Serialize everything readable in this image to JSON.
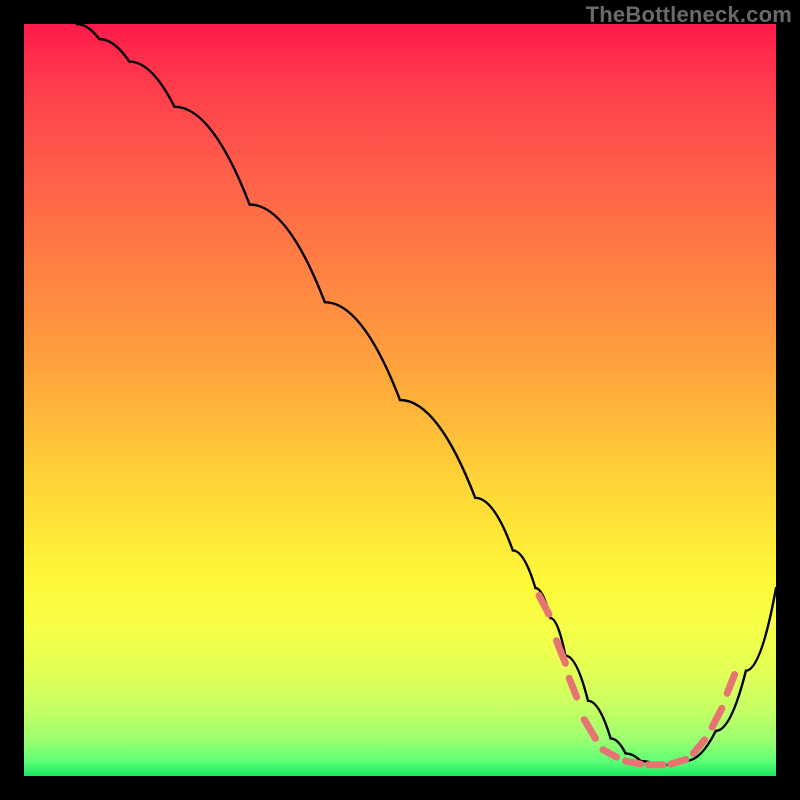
{
  "watermark": "TheBottleneck.com",
  "chart_data": {
    "type": "line",
    "title": "",
    "xlabel": "",
    "ylabel": "",
    "xlim": [
      0,
      100
    ],
    "ylim": [
      0,
      100
    ],
    "grid": false,
    "legend": false,
    "series": [
      {
        "name": "bottleneck-curve",
        "color": "#000000",
        "x": [
          7,
          10,
          14,
          20,
          30,
          40,
          50,
          60,
          65,
          68,
          70,
          72,
          75,
          78,
          80,
          82,
          84,
          86,
          88,
          92,
          96,
          100
        ],
        "y": [
          100,
          98,
          95,
          89,
          76,
          63,
          50,
          37,
          30,
          25,
          21,
          16,
          10,
          5,
          3,
          2,
          1.5,
          1.5,
          2,
          6,
          14,
          25
        ]
      }
    ],
    "markers": {
      "name": "flat-region-dashes",
      "color": "#e87373",
      "segments": [
        {
          "x1": 68.5,
          "y1": 24.0,
          "x2": 69.8,
          "y2": 21.5
        },
        {
          "x1": 70.8,
          "y1": 18.0,
          "x2": 72.0,
          "y2": 15.0
        },
        {
          "x1": 72.5,
          "y1": 13.0,
          "x2": 73.5,
          "y2": 10.5
        },
        {
          "x1": 74.5,
          "y1": 7.5,
          "x2": 76.0,
          "y2": 5.0
        },
        {
          "x1": 77.0,
          "y1": 3.5,
          "x2": 78.8,
          "y2": 2.5
        },
        {
          "x1": 80.0,
          "y1": 2.0,
          "x2": 82.0,
          "y2": 1.6
        },
        {
          "x1": 83.0,
          "y1": 1.5,
          "x2": 85.0,
          "y2": 1.5
        },
        {
          "x1": 86.0,
          "y1": 1.6,
          "x2": 88.0,
          "y2": 2.2
        },
        {
          "x1": 89.0,
          "y1": 3.0,
          "x2": 90.5,
          "y2": 4.8
        },
        {
          "x1": 91.5,
          "y1": 6.5,
          "x2": 92.8,
          "y2": 9.0
        },
        {
          "x1": 93.5,
          "y1": 11.0,
          "x2": 94.5,
          "y2": 13.5
        }
      ]
    }
  }
}
